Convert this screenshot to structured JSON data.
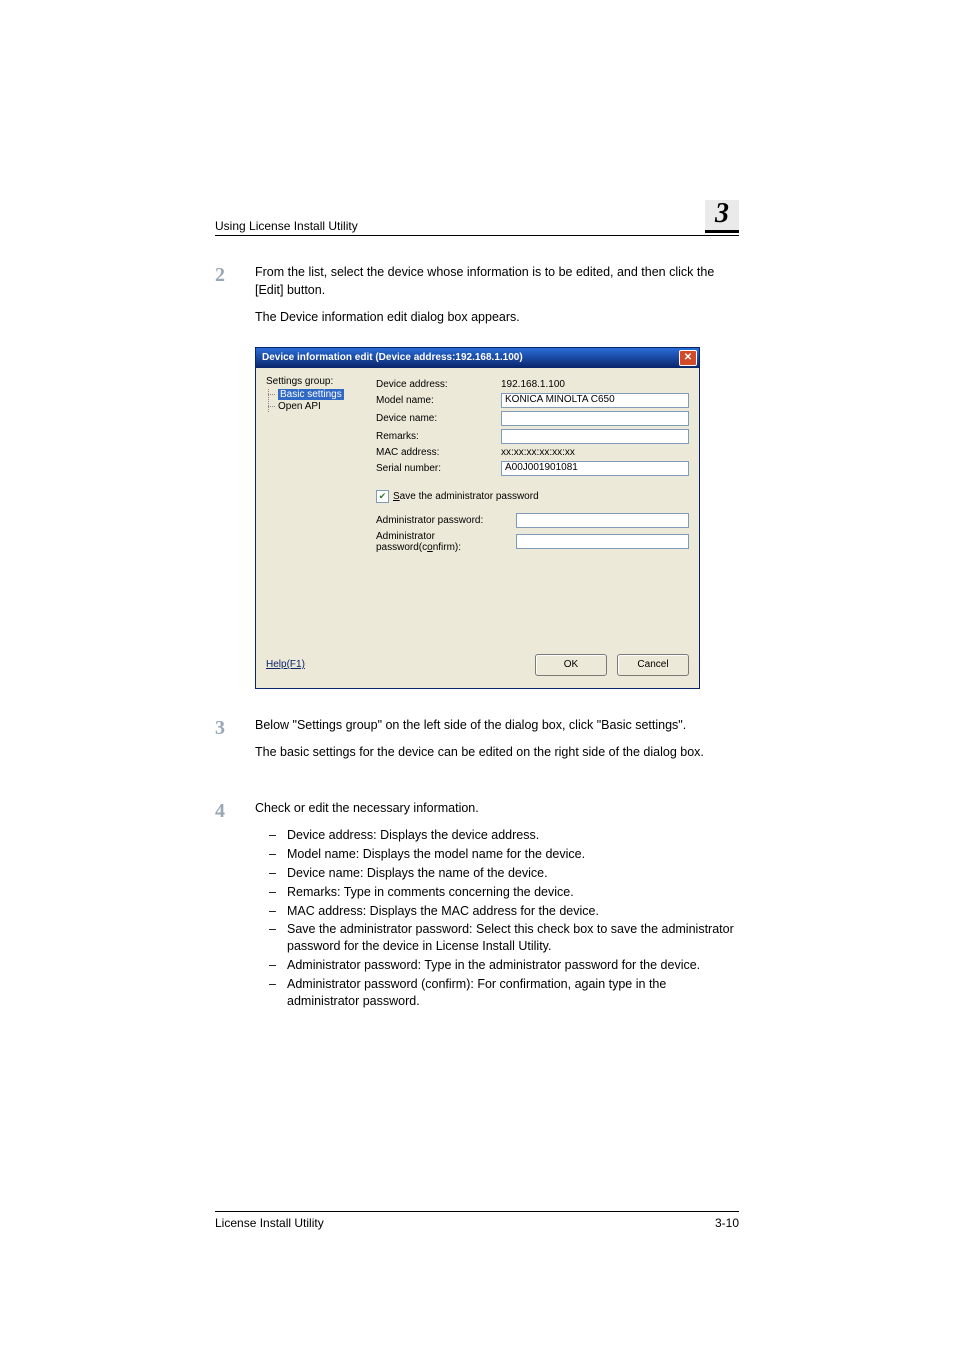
{
  "header": {
    "section_title": "Using License Install Utility",
    "chapter_number": "3"
  },
  "steps": {
    "s2": {
      "num": "2",
      "p1": "From the list, select the device whose information is to be edited, and then click the [Edit] button.",
      "p2": "The Device information edit dialog box appears."
    },
    "s3": {
      "num": "3",
      "p1": "Below \"Settings group\" on the left side of the dialog box, click \"Basic settings\".",
      "p2": "The basic settings for the device can be edited on the right side of the dialog box."
    },
    "s4": {
      "num": "4",
      "p1": "Check or edit the necessary information.",
      "bullets": [
        "Device address: Displays the device address.",
        "Model name: Displays the model name for the device.",
        "Device name: Displays the name of the device.",
        "Remarks: Type in comments concerning the device.",
        "MAC address: Displays the MAC address for the device.",
        "Save the administrator password: Select this check box to save the administrator password for the device in License Install Utility.",
        "Administrator password: Type in the administrator password for the device.",
        "Administrator password (confirm): For confirmation, again type in the administrator password."
      ]
    }
  },
  "dialog": {
    "title": "Device information edit (Device address:192.168.1.100)",
    "tree": {
      "heading": "Settings group:",
      "items": [
        "Basic settings",
        "Open API"
      ]
    },
    "fields": {
      "device_address": {
        "label": "Device address:",
        "value": "192.168.1.100"
      },
      "model_name": {
        "label": "Model name:",
        "value": "KONICA MINOLTA C650"
      },
      "device_name": {
        "label": "Device name:",
        "value": ""
      },
      "remarks": {
        "label": "Remarks:",
        "value": ""
      },
      "mac_address": {
        "label": "MAC address:",
        "value": "xx:xx:xx:xx:xx:xx"
      },
      "serial_number": {
        "label": "Serial number:",
        "value": "A00J001901081"
      },
      "save_pw_label_pre": "S",
      "save_pw_label_rest": "ave the administrator password",
      "admin_pw": {
        "label": "Administrator password:"
      },
      "admin_pw_c_pre": "Administrator password(c",
      "admin_pw_c_u": "o",
      "admin_pw_c_post": "nfirm):"
    },
    "help_label": "Help(F1)",
    "ok_label": "OK",
    "cancel_label": "Cancel"
  },
  "footer": {
    "left": "License Install Utility",
    "right": "3-10"
  }
}
